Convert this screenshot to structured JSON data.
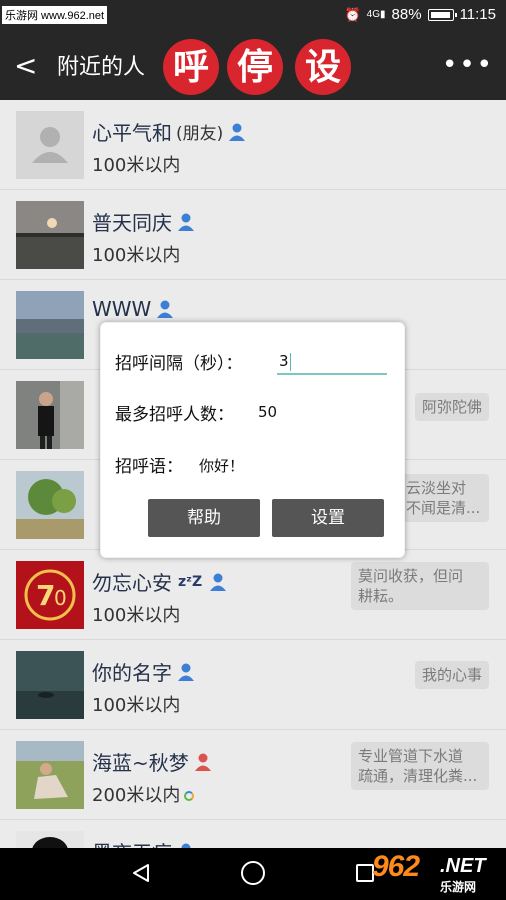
{
  "status_bar": {
    "watermark": "乐游网 www.962.net",
    "network": "4G",
    "battery": "88%",
    "time": "11:15"
  },
  "header": {
    "title": "附近的人",
    "buttons": [
      "呼",
      "停",
      "设"
    ],
    "more": "•••",
    "accent_color": "#d9252e"
  },
  "list": [
    {
      "name": "心平气和",
      "suffix": "(朋友)",
      "distance": "100米以内",
      "signature": "",
      "gender": "male"
    },
    {
      "name": "普天同庆",
      "suffix": "",
      "distance": "100米以内",
      "signature": "",
      "gender": "male"
    },
    {
      "name": "WWW",
      "suffix": "",
      "distance": "",
      "signature": "",
      "gender": "male"
    },
    {
      "name": "",
      "suffix": "",
      "distance": "",
      "signature": "阿弥陀佛",
      "gender": "male"
    },
    {
      "name": "",
      "suffix": "",
      "distance": "",
      "signature": "云淡坐对 不闻是清...",
      "gender": "male"
    },
    {
      "name": "勿忘心安",
      "suffix": "",
      "distance": "100米以内",
      "signature": "莫问收获，但问 耕耘。",
      "gender": "male"
    },
    {
      "name": "你的名字",
      "suffix": "",
      "distance": "100米以内",
      "signature": "我的心事",
      "gender": "male"
    },
    {
      "name": "海蓝~秋梦",
      "suffix": "",
      "distance": "200米以内",
      "signature": "专业管道下水道 疏通，清理化粪...",
      "gender": "female"
    },
    {
      "name": "黑夜无痕",
      "suffix": "",
      "distance": "",
      "signature": "",
      "gender": "male"
    }
  ],
  "dialog": {
    "interval_label": "招呼间隔（秒）：",
    "interval_value": "3",
    "max_label": "最多招呼人数：",
    "max_value": "50",
    "greeting_label": "招呼语：",
    "greeting_value": "你好！",
    "help_button": "帮助",
    "set_button": "设置"
  },
  "nav_bar": {
    "logo_number": "962",
    "logo_suffix": ".NET",
    "logo_text": "乐游网"
  }
}
